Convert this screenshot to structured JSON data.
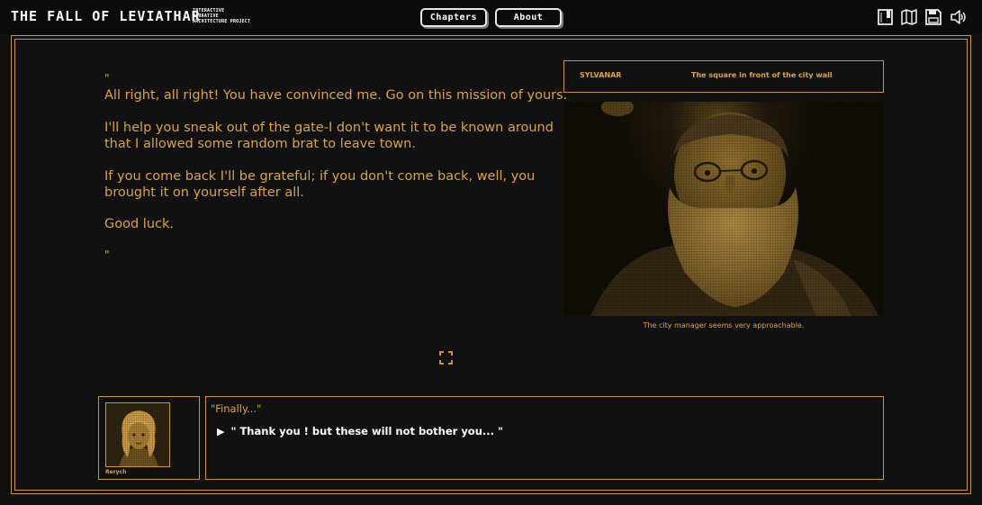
{
  "header": {
    "logo": "THE FALL OF LEVIATHAR",
    "tagline": [
      "INTERACTIVE",
      "NARRATIVE",
      "ARCHITECTURE PROJECT"
    ],
    "nav": {
      "chapters": "Chapters",
      "about": "About"
    },
    "icons": [
      "book-icon",
      "map-icon",
      "save-icon",
      "sound-icon"
    ]
  },
  "story": {
    "open_quote": "\"",
    "close_quote": "\"",
    "paragraphs": [
      "All right, all right! You have convinced me. Go on this mission of yours.",
      "I'll help you sneak out of the gate-I don't want it to be known around",
      "that I allowed some random brat to leave town.",
      "If you come back I'll be grateful; if you don't come back, well, you",
      "brought it on yourself after all.",
      "Good luck."
    ]
  },
  "scene": {
    "speaker": "SYLVANAR",
    "location": "The square in front of the city wall",
    "caption": "The city manager seems very approachable."
  },
  "player": {
    "name": "Rerych"
  },
  "dialog": {
    "line": "\"Finally...\"",
    "choice": "\" Thank you ! but these will not bother you... \""
  },
  "colors": {
    "accent": "#d9a441",
    "background": "#111111",
    "text_white": "#ffffff"
  }
}
